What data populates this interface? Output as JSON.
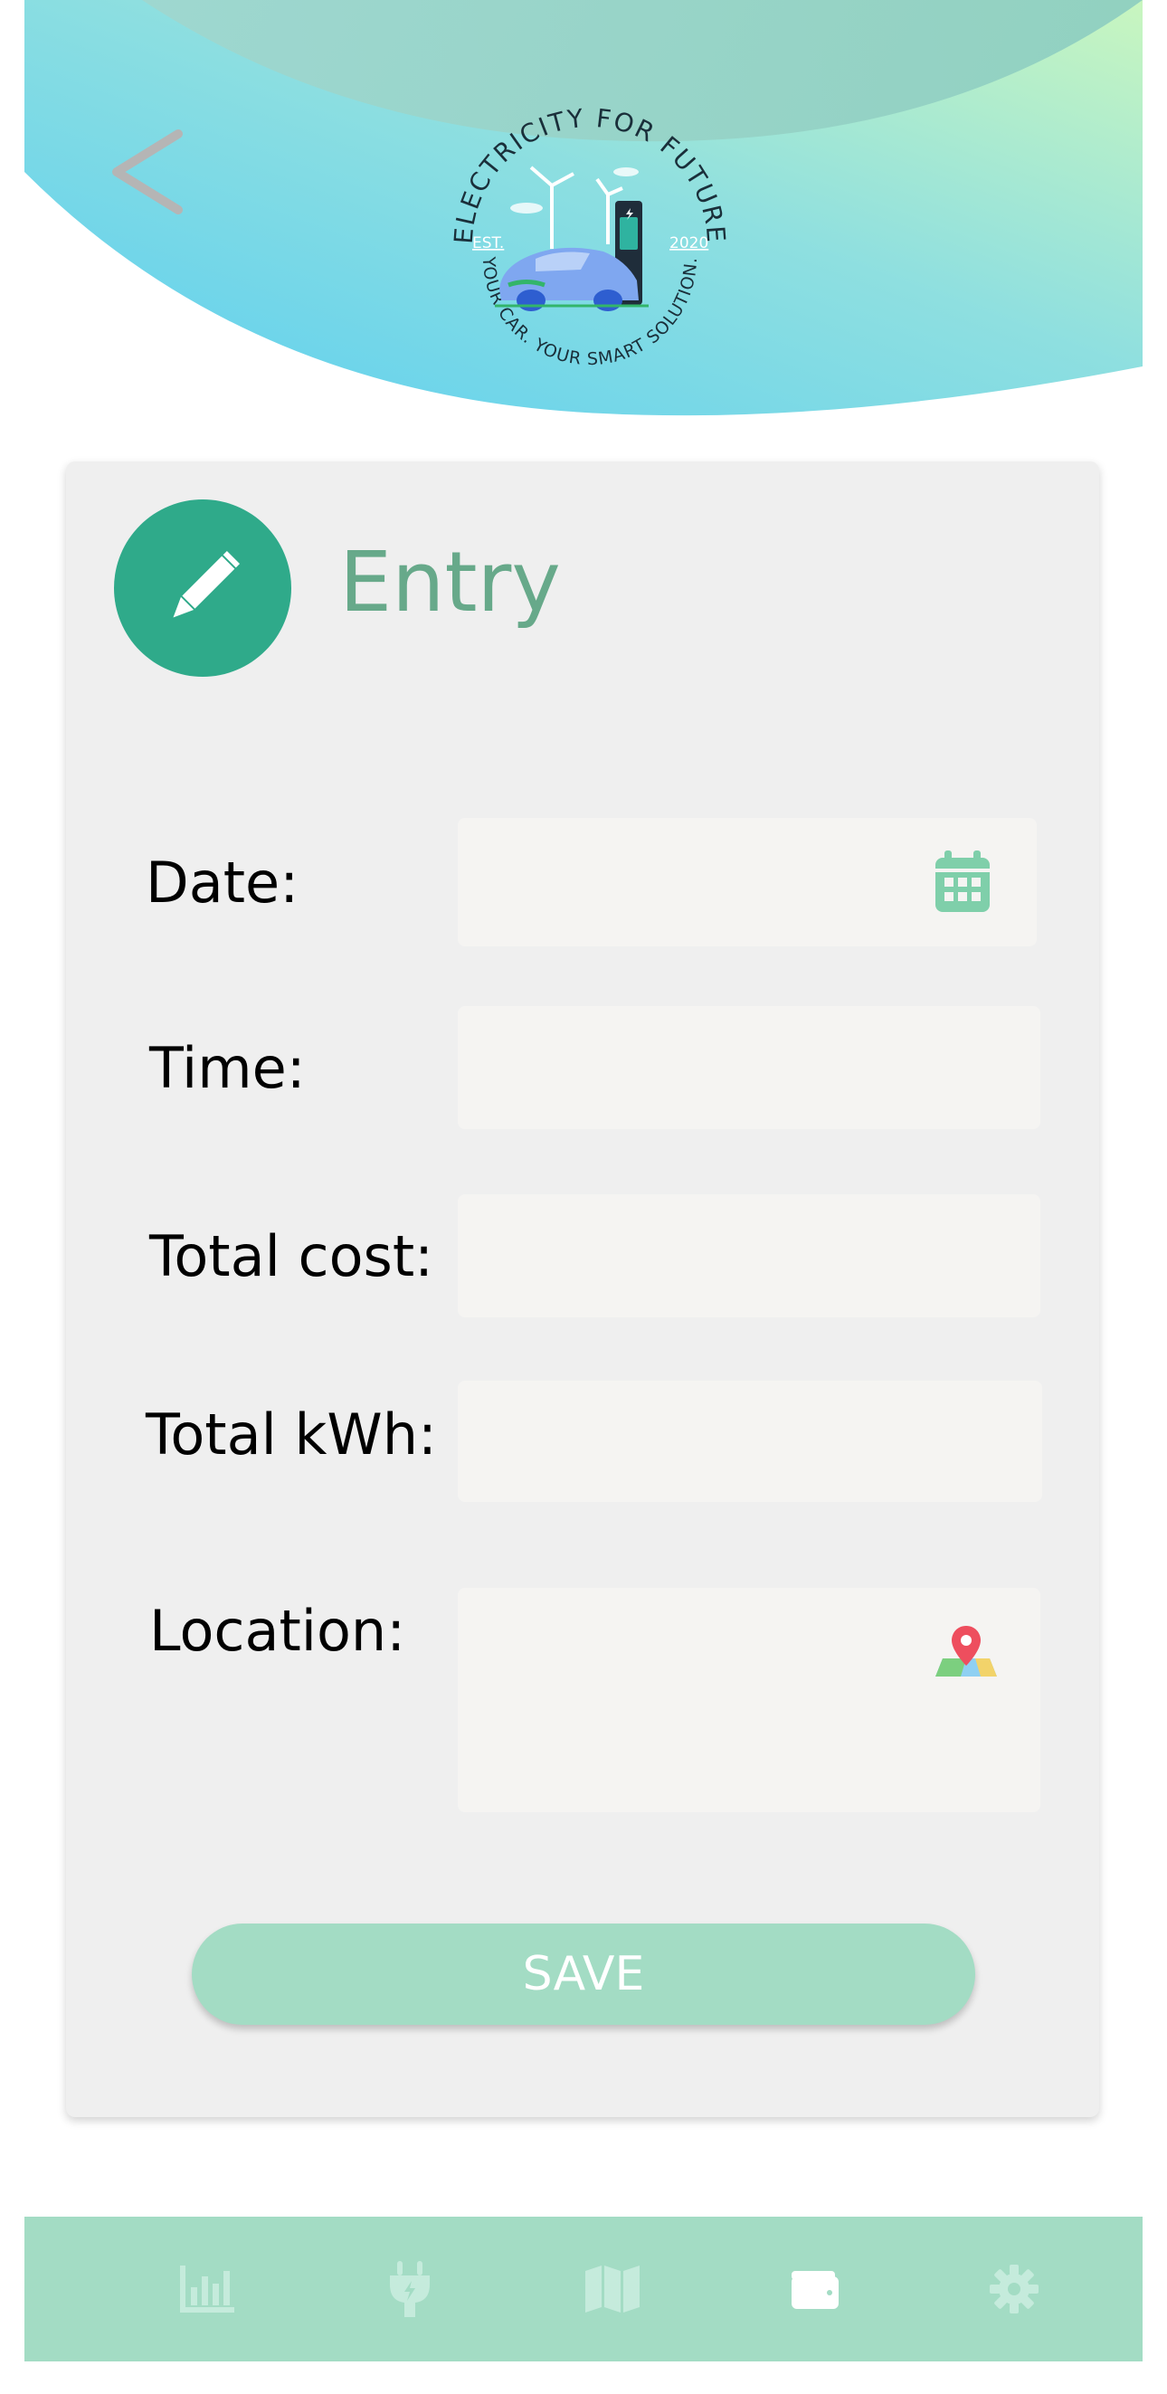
{
  "header": {
    "logo": {
      "top_text": "ELECTRICITY FOR FUTURE",
      "bottom_text": "YOUR CAR. YOUR SMART SOLUTION.",
      "est_label": "EST.",
      "year": "2020"
    }
  },
  "entry": {
    "title": "Entry",
    "fields": {
      "date": {
        "label": "Date:",
        "value": ""
      },
      "time": {
        "label": "Time:",
        "value": ""
      },
      "total_cost": {
        "label": "Total cost:",
        "value": ""
      },
      "total_kwh": {
        "label": "Total kWh:",
        "value": ""
      },
      "location": {
        "label": "Location:",
        "value": ""
      }
    },
    "save_label": "SAVE"
  },
  "bottom_nav": {
    "items": [
      {
        "icon": "bar-chart-icon",
        "active": false
      },
      {
        "icon": "plug-icon",
        "active": false
      },
      {
        "icon": "map-icon",
        "active": false
      },
      {
        "icon": "wallet-icon",
        "active": true
      },
      {
        "icon": "gear-icon",
        "active": false
      }
    ]
  },
  "colors": {
    "accent_green": "#2faa8a",
    "title_green": "#67a98a",
    "nav_background": "#a3dcc4",
    "save_button": "#a3dcc4",
    "card_background": "#efefef",
    "input_background": "#f5f4f2",
    "header_gradient_start": "#5fd0ec",
    "header_gradient_end": "#c7f5c1"
  }
}
